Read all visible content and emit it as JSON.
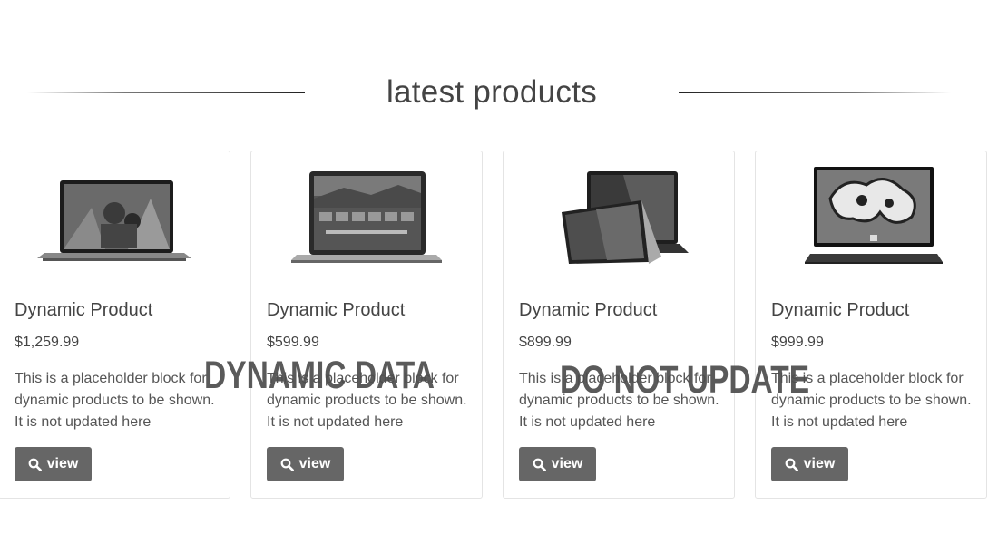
{
  "section": {
    "title": "latest products"
  },
  "products": [
    {
      "name": "Dynamic Product",
      "price": "$1,259.99",
      "description": "This is a placeholder block for dynamic products to be shown. It is not updated here",
      "button_label": "view",
      "button_icon": "search-icon",
      "image_icon": "laptop-icon"
    },
    {
      "name": "Dynamic Product",
      "price": "$599.99",
      "description": "This is a placeholder block for dynamic products to be shown. It is not updated here",
      "button_label": "view",
      "button_icon": "search-icon",
      "image_icon": "laptop-icon"
    },
    {
      "name": "Dynamic Product",
      "price": "$899.99",
      "description": "This is a placeholder block for dynamic products to be shown. It is not updated here",
      "button_label": "view",
      "button_icon": "search-icon",
      "image_icon": "convertible-laptop-icon"
    },
    {
      "name": "Dynamic Product",
      "price": "$999.99",
      "description": "This is a placeholder block for dynamic products to be shown. It is not updated here",
      "button_label": "view",
      "button_icon": "search-icon",
      "image_icon": "tablet-keyboard-icon"
    }
  ],
  "watermarks": [
    "DYNAMIC DATA",
    "DO NOT UPDATE"
  ],
  "colors": {
    "button_bg": "#666666",
    "button_text": "#ffffff",
    "border": "#e4e4e4",
    "text": "#444444"
  }
}
